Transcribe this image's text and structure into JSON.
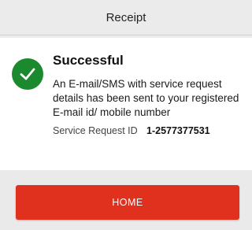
{
  "header": {
    "title": "Receipt"
  },
  "receipt": {
    "status_icon": "check-circle-icon",
    "status_color": "#1b8a2f",
    "title": "Successful",
    "message": "An E-mail/SMS with service request details has been sent to your registered E-mail id/ mobile number",
    "service_request_label": "Service Request ID",
    "service_request_value": "1-2577377531"
  },
  "footer": {
    "home_button_label": "HOME",
    "home_button_color": "#e0301e"
  }
}
